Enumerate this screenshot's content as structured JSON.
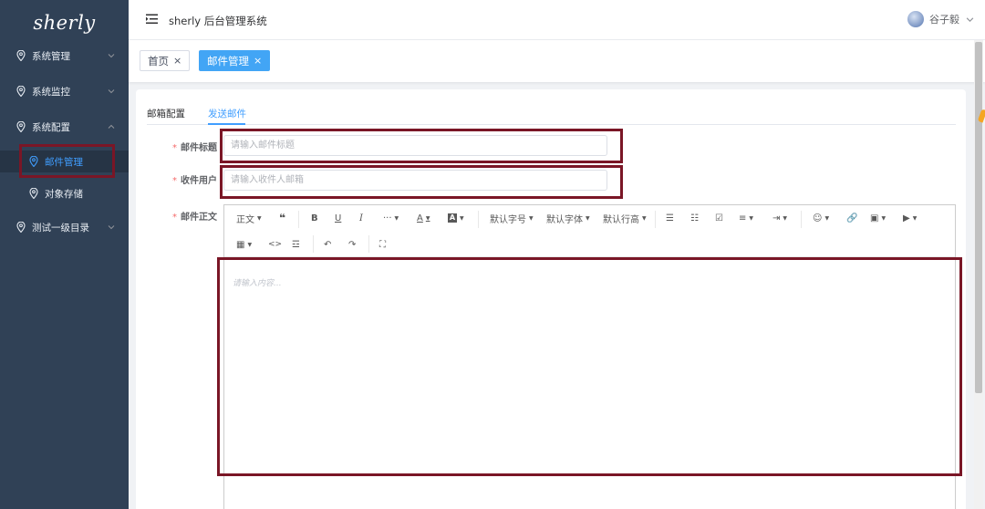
{
  "sidebar": {
    "logo": "sherly",
    "menu": [
      {
        "label": "系统管理",
        "icon": "location-pin-icon",
        "expanded": false
      },
      {
        "label": "系统监控",
        "icon": "location-pin-icon",
        "expanded": false
      },
      {
        "label": "系统配置",
        "icon": "location-pin-icon",
        "expanded": true
      },
      {
        "label": "测试一级目录",
        "icon": "location-pin-icon",
        "expanded": false
      }
    ],
    "submenu": [
      {
        "label": "邮件管理",
        "icon": "location-pin-icon",
        "active": true
      },
      {
        "label": "对象存储",
        "icon": "location-pin-icon",
        "active": false
      }
    ]
  },
  "header": {
    "title": "sherly 后台管理系统",
    "user_name": "谷子毅"
  },
  "tags": [
    {
      "label": "首页",
      "active": false
    },
    {
      "label": "邮件管理",
      "active": true
    }
  ],
  "tabs": [
    {
      "label": "邮箱配置",
      "active": false
    },
    {
      "label": "发送邮件",
      "active": true
    }
  ],
  "form": {
    "subject_label": "邮件标题",
    "subject_placeholder": "请输入邮件标题",
    "recipient_label": "收件用户",
    "recipient_placeholder": "请输入收件人邮箱",
    "body_label": "邮件正文",
    "required_mark": "*"
  },
  "editor": {
    "toolbar": {
      "heading": "正文",
      "font_size": "默认字号",
      "font_family": "默认字体",
      "line_height": "默认行高",
      "more": "···"
    },
    "placeholder": "请输入内容..."
  },
  "colors": {
    "sidebar_bg": "#304156",
    "accent": "#409eff",
    "active_tag": "#42a5f5",
    "highlight_box": "#7a1626"
  }
}
